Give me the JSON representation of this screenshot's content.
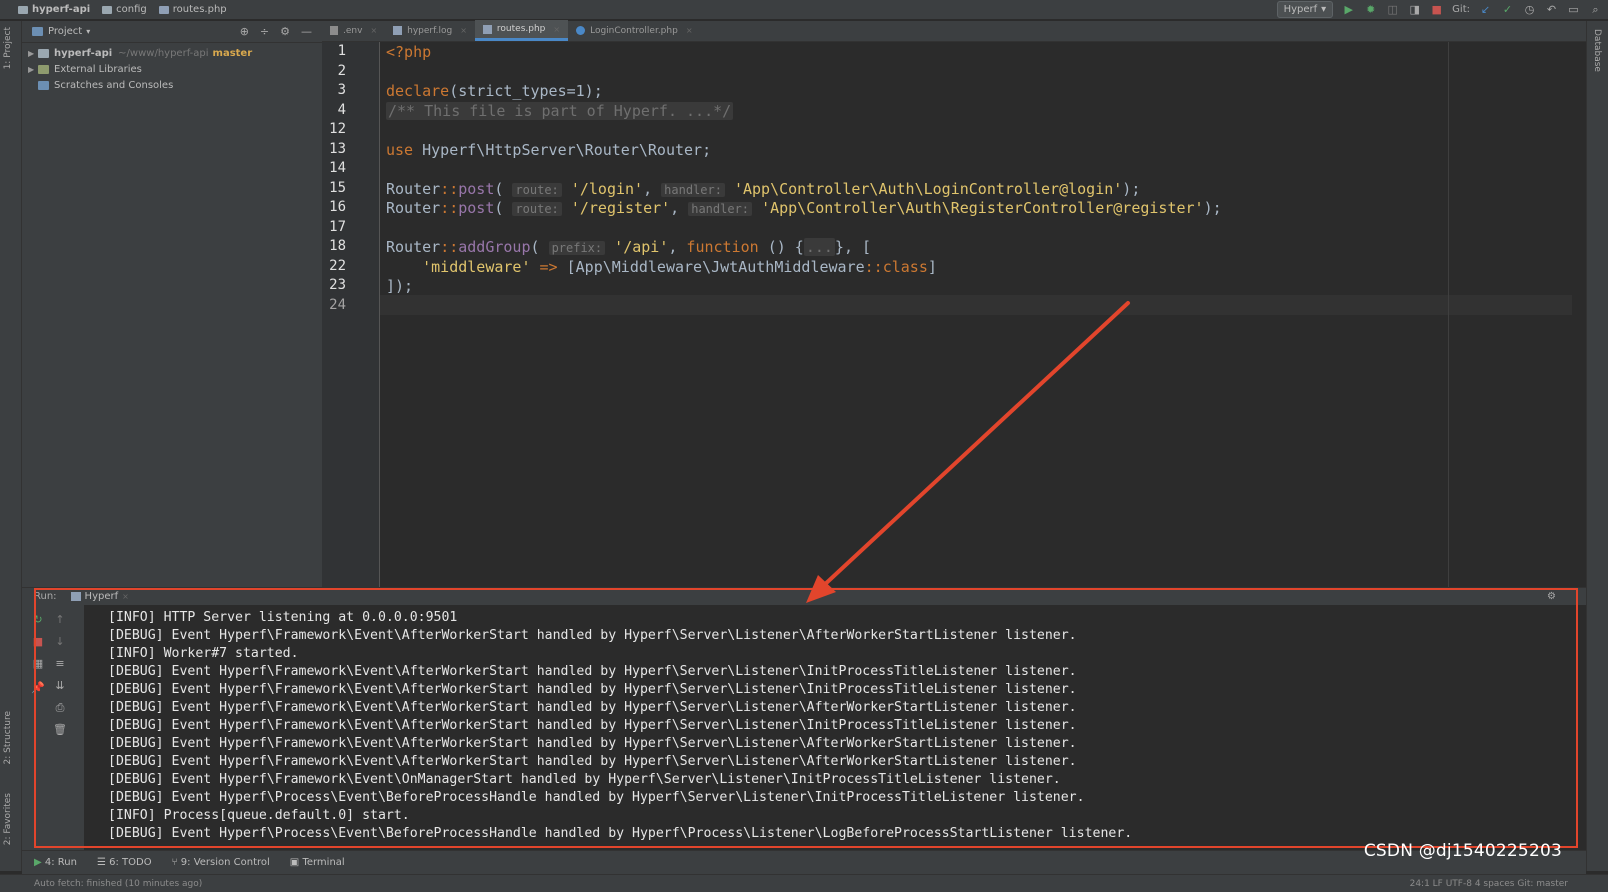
{
  "breadcrumb": [
    "hyperf-api",
    "config",
    "routes.php"
  ],
  "run_config": "Hyperf",
  "vcs_label": "Git:",
  "project_panel": {
    "title": "Project",
    "tree": [
      {
        "label": "hyperf-api",
        "path": "~/www/hyperf-api",
        "branch": "master"
      },
      {
        "label": "External Libraries"
      },
      {
        "label": "Scratches and Consoles"
      }
    ]
  },
  "left_tool_labels": [
    "1: Project",
    "2: Structure",
    "2: Favorites"
  ],
  "right_tool_labels": [
    "Database"
  ],
  "tabs": [
    ".env",
    "hyperf.log",
    "routes.php",
    "LoginController.php"
  ],
  "active_tab": "routes.php",
  "editor": {
    "line_numbers": [
      "1",
      "2",
      "3",
      "4",
      "12",
      "13",
      "14",
      "15",
      "16",
      "17",
      "18",
      "22",
      "23",
      "24"
    ],
    "line1": "<?php",
    "l3_kw": "declare",
    "l3_rest": "(strict_types=1);",
    "l4_comment": "/** This file is part of Hyperf. ...*/",
    "l13_kw": "use",
    "l13_rest": " Hyperf\\HttpServer\\Router\\Router;",
    "router": "Router",
    "sep": "::",
    "post": "post",
    "hint_route": "route:",
    "hint_handler": "handler:",
    "hint_prefix": "prefix:",
    "l15_route": "'/login'",
    "l15_handler": "'App\\Controller\\Auth\\LoginController@login'",
    "l16_route": "'/register'",
    "l16_handler": "'App\\Controller\\Auth\\RegisterController@register'",
    "addGroup": "addGroup",
    "l18_prefix": "'/api'",
    "function_kw": "function",
    "fold": "...",
    "l22_key": "'middleware'",
    "arrow_op": "=>",
    "l22_class": "[App\\Middleware\\JwtAuthMiddleware",
    "class_kw": "class",
    "l23": "]);"
  },
  "run_panel": {
    "label": "Run:",
    "tab": "Hyperf",
    "console_lines": [
      "[INFO] HTTP Server listening at 0.0.0.0:9501",
      "[DEBUG] Event Hyperf\\Framework\\Event\\AfterWorkerStart handled by Hyperf\\Server\\Listener\\AfterWorkerStartListener listener.",
      "[INFO] Worker#7 started.",
      "[DEBUG] Event Hyperf\\Framework\\Event\\AfterWorkerStart handled by Hyperf\\Server\\Listener\\InitProcessTitleListener listener.",
      "[DEBUG] Event Hyperf\\Framework\\Event\\AfterWorkerStart handled by Hyperf\\Server\\Listener\\InitProcessTitleListener listener.",
      "[DEBUG] Event Hyperf\\Framework\\Event\\AfterWorkerStart handled by Hyperf\\Server\\Listener\\AfterWorkerStartListener listener.",
      "[DEBUG] Event Hyperf\\Framework\\Event\\AfterWorkerStart handled by Hyperf\\Server\\Listener\\InitProcessTitleListener listener.",
      "[DEBUG] Event Hyperf\\Framework\\Event\\AfterWorkerStart handled by Hyperf\\Server\\Listener\\AfterWorkerStartListener listener.",
      "[DEBUG] Event Hyperf\\Framework\\Event\\AfterWorkerStart handled by Hyperf\\Server\\Listener\\AfterWorkerStartListener listener.",
      "[DEBUG] Event Hyperf\\Framework\\Event\\OnManagerStart handled by Hyperf\\Server\\Listener\\InitProcessTitleListener listener.",
      "[DEBUG] Event Hyperf\\Process\\Event\\BeforeProcessHandle handled by Hyperf\\Server\\Listener\\InitProcessTitleListener listener.",
      "[INFO] Process[queue.default.0] start.",
      "[DEBUG] Event Hyperf\\Process\\Event\\BeforeProcessHandle handled by Hyperf\\Process\\Listener\\LogBeforeProcessStartListener listener."
    ]
  },
  "tool_windows": [
    "4: Run",
    "6: TODO",
    "9: Version Control",
    "Terminal"
  ],
  "status": {
    "left": "Auto fetch: finished (10 minutes ago)",
    "right": "24:1  LF  UTF-8  4 spaces  Git: master"
  },
  "watermark": "CSDN @dj1540225203",
  "colors": {
    "annotation": "#e2452c",
    "keyword": "#cc7832",
    "string": "#6a8759",
    "background": "#2b2b2b"
  }
}
